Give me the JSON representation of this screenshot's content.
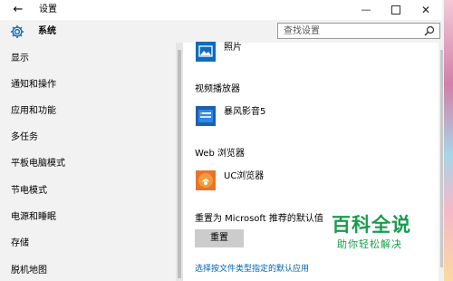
{
  "window": {
    "title": "设置",
    "back_icon": "back-arrow-icon",
    "controls": {
      "minimize": "—",
      "close": "✕"
    }
  },
  "header": {
    "title": "系统",
    "icon": "gear-icon",
    "search_placeholder": "查找设置"
  },
  "sidebar": {
    "items": [
      {
        "label": "显示"
      },
      {
        "label": "通知和操作"
      },
      {
        "label": "应用和功能"
      },
      {
        "label": "多任务"
      },
      {
        "label": "平板电脑模式"
      },
      {
        "label": "节电模式"
      },
      {
        "label": "电源和睡眠"
      },
      {
        "label": "存储"
      },
      {
        "label": "脱机地图"
      }
    ]
  },
  "content": {
    "photo_app": {
      "label": "照片",
      "icon": "photos-app-icon"
    },
    "video": {
      "heading": "视频播放器",
      "app_label": "暴风影音5",
      "icon": "baofeng-app-icon"
    },
    "browser": {
      "heading": "Web 浏览器",
      "app_label": "UC浏览器",
      "icon": "uc-browser-icon"
    },
    "reset": {
      "heading": "重置为 Microsoft 推荐的默认值",
      "button": "重置"
    },
    "link": "选择按文件类型指定的默认应用"
  },
  "watermark": {
    "title": "百科全说",
    "subtitle": "助你轻松解决"
  },
  "colors": {
    "accent": "#0063b1",
    "watermark": "#1a9c4e"
  }
}
